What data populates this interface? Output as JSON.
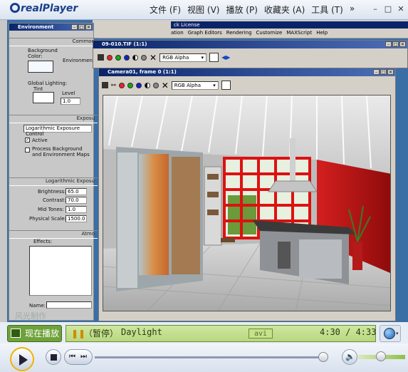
{
  "app": {
    "logo_text": "realPlayer"
  },
  "menu": [
    "文件 (F)",
    "视图 (V)",
    "播放 (P)",
    "收藏夹 (A)",
    "工具 (T)",
    "»"
  ],
  "window_buttons": {
    "minimize": "–",
    "maximize": "□",
    "close": "✕"
  },
  "environment_panel": {
    "title": "Environment",
    "common_section": "Common",
    "background_label": "Background",
    "color_label": "Color:",
    "environment_label": "Environment",
    "global_lighting_label": "Global Lighting:",
    "tint_label": "Tint",
    "level_label": "Level",
    "level_value": "1.0",
    "exposure_section": "Exposu",
    "exposure_control_value": "Logarithmic Exposure Control",
    "active_label": "Active",
    "process_background_label": "Process Background and Environment Maps",
    "log_exposure_section": "Logarithmic Exposu",
    "brightness_label": "Brightness:",
    "brightness_value": "65.0",
    "contrast_label": "Contrast:",
    "contrast_value": "70.0",
    "midtones_label": "Mid Tones:",
    "midtones_value": "1.0",
    "physical_scale_label": "Physical Scale:",
    "physical_scale_value": "1500.0",
    "atmosphere_section": "Atmo",
    "effects_label": "Effects:",
    "name_label": "Name:",
    "watermark": "风光制作"
  },
  "max_app": {
    "title": "ck License",
    "menu": [
      "ation",
      "Graph Editors",
      "Rendering",
      "Customize",
      "MAXScript",
      "Help"
    ]
  },
  "vfb_back": {
    "title": "09-010.TIF (1:1)",
    "channel": "RGB Alpha"
  },
  "vfb_front": {
    "title": "Camera01, frame 0 (1:1)",
    "channel": "RGB Alpha"
  },
  "status": {
    "now_playing": "现在播放",
    "playback_state": "（暂停）",
    "track": "Daylight",
    "format": "avi",
    "time": "4:30 / 4:33"
  },
  "colors": {
    "accent_green": "#6fa23a",
    "lcd": "#c3df8c",
    "kitchen_red": "#c01818"
  }
}
